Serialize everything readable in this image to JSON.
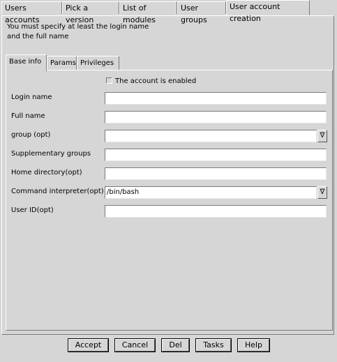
{
  "top_tabs": [
    {
      "label": "Users accounts"
    },
    {
      "label": "Pick a version"
    },
    {
      "label": "List of modules"
    },
    {
      "label": "User groups"
    },
    {
      "label": "User account creation"
    }
  ],
  "message": {
    "line1": "You must specify at least the login name",
    "line2": "and the full name"
  },
  "inner_tabs": [
    {
      "label": "Base info"
    },
    {
      "label": "Params"
    },
    {
      "label": "Privileges"
    }
  ],
  "form": {
    "enabled_label": "The account is enabled",
    "login_label": "Login name",
    "login_value": "",
    "fullname_label": "Full name",
    "fullname_value": "",
    "group_label": "group (opt)",
    "group_value": "",
    "supp_label": "Supplementary groups",
    "supp_value": "",
    "home_label": "Home directory(opt)",
    "home_value": "",
    "shell_label": "Command interpreter(opt)",
    "shell_value": "/bin/bash",
    "uid_label": "User ID(opt)",
    "uid_value": "",
    "combo_glyph": "∇"
  },
  "buttons": {
    "accept": "Accept",
    "cancel": "Cancel",
    "del": "Del",
    "tasks": "Tasks",
    "help": "Help"
  }
}
